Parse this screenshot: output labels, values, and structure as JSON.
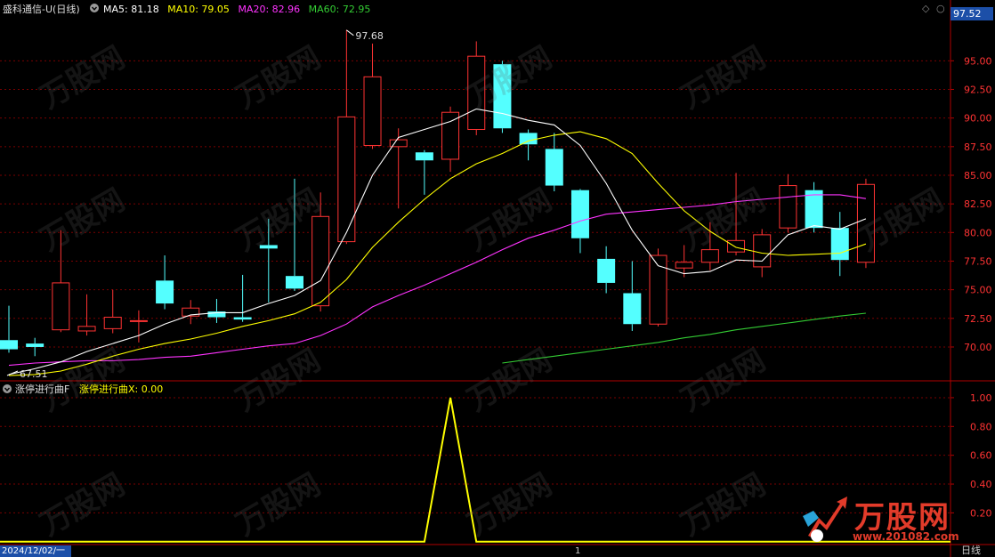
{
  "header": {
    "stock_title": "盛科通信-U",
    "period": "(日线)",
    "ma_items": [
      {
        "label": "MA5: 81.18",
        "color": "#ffffff"
      },
      {
        "label": "MA10: 79.05",
        "color": "#ffff00"
      },
      {
        "label": "MA20: 82.96",
        "color": "#ff33ff"
      },
      {
        "label": "MA60: 72.95",
        "color": "#33cc33"
      }
    ],
    "price_tag": "97.52"
  },
  "indicator": {
    "name": "涨停进行曲F",
    "value_label": "涨停进行曲X: 0.00"
  },
  "bottom": {
    "date_label": "2024/12/02/一",
    "tick_mark": "1",
    "period_label": "日线"
  },
  "watermark": {
    "brand": "万股网",
    "url": "www.201082.com"
  },
  "colors": {
    "up": "#ff3333",
    "down": "#54ffff",
    "grid": "#7a0000",
    "axis_text": "#ff3333",
    "ma5": "#ffffff",
    "ma10": "#ffff00",
    "ma20": "#ff33ff",
    "ma60": "#33cc33",
    "indicator": "#ffff00"
  },
  "chart_data": [
    {
      "type": "candlestick",
      "yticks": [
        70.0,
        72.5,
        75.0,
        77.5,
        80.0,
        82.5,
        85.0,
        87.5,
        90.0,
        92.5,
        95.0
      ],
      "ylim": [
        67.2,
        98.6
      ],
      "annotations": [
        {
          "text": "97.68",
          "value": 97.68,
          "index": 13
        },
        {
          "text": "67.51",
          "value": 67.51,
          "index": 0
        }
      ],
      "candles": [
        {
          "o": 70.6,
          "h": 73.6,
          "l": 69.5,
          "c": 69.8
        },
        {
          "o": 70.3,
          "h": 70.8,
          "l": 69.2,
          "c": 70.0
        },
        {
          "o": 71.5,
          "h": 80.2,
          "l": 71.3,
          "c": 75.6
        },
        {
          "o": 71.4,
          "h": 74.6,
          "l": 71.0,
          "c": 71.8
        },
        {
          "o": 71.6,
          "h": 75.0,
          "l": 71.2,
          "c": 72.6
        },
        {
          "o": 72.3,
          "h": 73.2,
          "l": 70.4,
          "c": 72.3
        },
        {
          "o": 75.8,
          "h": 78.0,
          "l": 73.3,
          "c": 73.8
        },
        {
          "o": 72.7,
          "h": 74.1,
          "l": 72.0,
          "c": 73.4
        },
        {
          "o": 73.1,
          "h": 74.2,
          "l": 72.1,
          "c": 72.6
        },
        {
          "o": 72.6,
          "h": 76.3,
          "l": 72.2,
          "c": 72.4
        },
        {
          "o": 78.9,
          "h": 81.2,
          "l": 73.9,
          "c": 78.6
        },
        {
          "o": 76.2,
          "h": 84.7,
          "l": 74.9,
          "c": 75.1
        },
        {
          "o": 73.6,
          "h": 83.5,
          "l": 73.1,
          "c": 81.4
        },
        {
          "o": 79.2,
          "h": 97.7,
          "l": 79.0,
          "c": 90.1
        },
        {
          "o": 87.6,
          "h": 96.5,
          "l": 87.3,
          "c": 93.6
        },
        {
          "o": 87.5,
          "h": 89.1,
          "l": 82.1,
          "c": 88.1
        },
        {
          "o": 87.0,
          "h": 87.2,
          "l": 83.3,
          "c": 86.3
        },
        {
          "o": 86.4,
          "h": 91.0,
          "l": 85.3,
          "c": 90.5
        },
        {
          "o": 89.0,
          "h": 96.7,
          "l": 88.5,
          "c": 95.4
        },
        {
          "o": 94.7,
          "h": 95.0,
          "l": 88.7,
          "c": 89.1
        },
        {
          "o": 88.7,
          "h": 89.0,
          "l": 86.3,
          "c": 87.7
        },
        {
          "o": 87.3,
          "h": 88.7,
          "l": 83.6,
          "c": 84.1
        },
        {
          "o": 83.7,
          "h": 83.8,
          "l": 78.2,
          "c": 79.5
        },
        {
          "o": 77.7,
          "h": 78.8,
          "l": 74.7,
          "c": 75.6
        },
        {
          "o": 74.7,
          "h": 77.5,
          "l": 71.4,
          "c": 72.0
        },
        {
          "o": 72.0,
          "h": 78.6,
          "l": 71.8,
          "c": 78.0
        },
        {
          "o": 76.9,
          "h": 78.9,
          "l": 76.1,
          "c": 77.4
        },
        {
          "o": 77.4,
          "h": 80.9,
          "l": 76.7,
          "c": 78.5
        },
        {
          "o": 78.3,
          "h": 85.2,
          "l": 78.0,
          "c": 79.3
        },
        {
          "o": 77.0,
          "h": 80.3,
          "l": 76.1,
          "c": 79.8
        },
        {
          "o": 80.4,
          "h": 85.1,
          "l": 80.0,
          "c": 84.1
        },
        {
          "o": 83.7,
          "h": 84.4,
          "l": 80.0,
          "c": 80.4
        },
        {
          "o": 80.4,
          "h": 81.8,
          "l": 76.2,
          "c": 77.6
        },
        {
          "o": 77.4,
          "h": 84.7,
          "l": 76.9,
          "c": 84.2
        }
      ],
      "ma5": [
        67.6,
        68.1,
        68.7,
        69.6,
        70.3,
        71.0,
        72.0,
        72.8,
        73.0,
        73.0,
        73.8,
        74.5,
        75.8,
        80.0,
        85.0,
        88.3,
        89.0,
        89.7,
        90.8,
        90.4,
        89.8,
        89.4,
        87.6,
        84.3,
        80.2,
        77.1,
        76.4,
        76.6,
        77.6,
        77.5,
        79.8,
        80.6,
        80.3,
        81.2
      ],
      "ma10": [
        67.5,
        67.6,
        67.9,
        68.5,
        69.2,
        69.8,
        70.3,
        70.7,
        71.2,
        71.8,
        72.3,
        72.9,
        73.9,
        75.9,
        78.7,
        80.9,
        82.9,
        84.7,
        86.0,
        86.9,
        88.0,
        88.5,
        88.8,
        88.2,
        86.9,
        84.3,
        81.9,
        80.1,
        78.7,
        78.2,
        78.0,
        78.1,
        78.2,
        79.0
      ],
      "ma20": [
        68.4,
        68.6,
        68.7,
        68.8,
        68.8,
        68.9,
        69.1,
        69.2,
        69.5,
        69.8,
        70.1,
        70.3,
        71.0,
        72.0,
        73.5,
        74.5,
        75.4,
        76.4,
        77.4,
        78.5,
        79.5,
        80.2,
        81.0,
        81.6,
        81.8,
        82.0,
        82.2,
        82.4,
        82.7,
        82.9,
        83.1,
        83.3,
        83.3,
        82.96
      ],
      "ma60_start_index": 19,
      "ma60": [
        68.6,
        68.9,
        69.2,
        69.5,
        69.8,
        70.1,
        70.4,
        70.8,
        71.1,
        71.5,
        71.8,
        72.1,
        72.4,
        72.7,
        72.95
      ]
    },
    {
      "type": "line",
      "yticks": [
        0.2,
        0.4,
        0.6,
        0.8,
        1.0
      ],
      "ylim": [
        -0.02,
        1.08
      ],
      "series": [
        {
          "name": "涨停进行曲X",
          "values": [
            0,
            0,
            0,
            0,
            0,
            0,
            0,
            0,
            0,
            0,
            0,
            0,
            0,
            0,
            0,
            0,
            0,
            1,
            0,
            0,
            0,
            0,
            0,
            0,
            0,
            0,
            0,
            0,
            0,
            0,
            0,
            0,
            0,
            0
          ]
        }
      ]
    }
  ]
}
